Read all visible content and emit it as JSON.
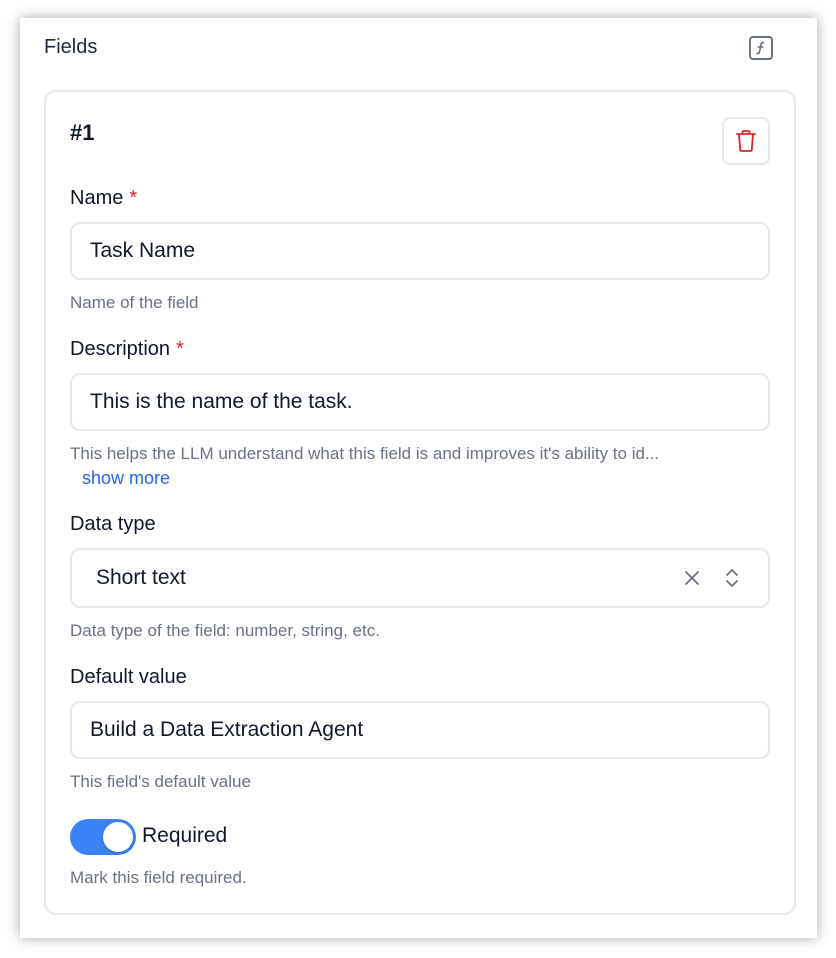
{
  "panel": {
    "title": "Fields",
    "function_icon": "function-icon"
  },
  "field": {
    "index": "#1",
    "delete_icon": "trash-icon",
    "name": {
      "label": "Name",
      "required_mark": "*",
      "value": "Task Name",
      "help": "Name of the field"
    },
    "description": {
      "label": "Description",
      "required_mark": "*",
      "value": "This is the name of the task.",
      "help": "This helps the LLM understand what this field is and improves it's ability to id...",
      "show_more": "show more"
    },
    "data_type": {
      "label": "Data type",
      "value": "Short text",
      "help": "Data type of the field: number, string, etc."
    },
    "default_value": {
      "label": "Default value",
      "value": "Build a Data Extraction Agent",
      "help": "This field's default value"
    },
    "required": {
      "label": "Required",
      "enabled": true,
      "help": "Mark this field required."
    }
  },
  "colors": {
    "accent": "#3b82f6",
    "danger": "#dc2626",
    "link": "#2563eb"
  }
}
